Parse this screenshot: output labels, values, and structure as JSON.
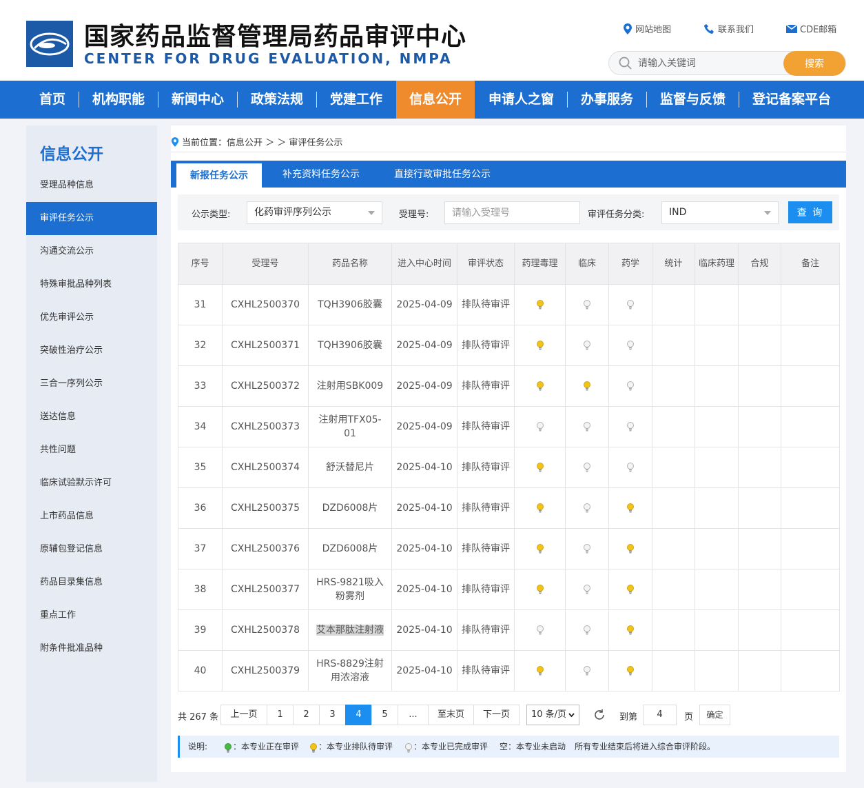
{
  "header": {
    "title": "国家药品监督管理局药品审评中心",
    "subtitle": "CENTER FOR DRUG EVALUATION, NMPA",
    "links": [
      {
        "label": "网站地图",
        "icon": "location-pin-icon"
      },
      {
        "label": "联系我们",
        "icon": "phone-icon"
      },
      {
        "label": "CDE邮箱",
        "icon": "mail-icon"
      }
    ],
    "search_placeholder": "请输入关键词",
    "search_button": "搜索"
  },
  "nav": {
    "items": [
      "首页",
      "机构职能",
      "新闻中心",
      "政策法规",
      "党建工作",
      "信息公开",
      "申请人之窗",
      "办事服务",
      "监督与反馈",
      "登记备案平台"
    ],
    "active": "信息公开"
  },
  "sidebar": {
    "title": "信息公开",
    "items": [
      "受理品种信息",
      "审评任务公示",
      "沟通交流公示",
      "特殊审批品种列表",
      "优先审评公示",
      "突破性治疗公示",
      "三合一序列公示",
      "送达信息",
      "共性问题",
      "临床试验默示许可",
      "上市药品信息",
      "原辅包登记信息",
      "药品目录集信息",
      "重点工作",
      "附条件批准品种"
    ],
    "active": "审评任务公示"
  },
  "breadcrumb": {
    "text": "当前位置：信息公开 ＞ ＞ 审评任务公示"
  },
  "tabs": {
    "items": [
      "新报任务公示",
      "补充资料任务公示",
      "直接行政审批任务公示"
    ],
    "active": "新报任务公示"
  },
  "filter": {
    "type_label": "公示类型:",
    "type_value": "化药审评序列公示",
    "accept_label": "受理号:",
    "accept_placeholder": "请输入受理号",
    "category_label": "审评任务分类:",
    "category_value": "IND",
    "query_button": "查 询"
  },
  "table": {
    "headers": [
      "序号",
      "受理号",
      "药品名称",
      "进入中心时间",
      "审评状态",
      "药理毒理",
      "临床",
      "药学",
      "统计",
      "临床药理",
      "合规",
      "备注"
    ],
    "rows": [
      {
        "no": "31",
        "id": "CXHL2500370",
        "name": "TQH3906胶囊",
        "date": "2025-04-09",
        "status": "排队待审评",
        "tox": "queued",
        "clin": "done",
        "pharm": "done"
      },
      {
        "no": "32",
        "id": "CXHL2500371",
        "name": "TQH3906胶囊",
        "date": "2025-04-09",
        "status": "排队待审评",
        "tox": "queued",
        "clin": "done",
        "pharm": "done"
      },
      {
        "no": "33",
        "id": "CXHL2500372",
        "name": "注射用SBK009",
        "date": "2025-04-09",
        "status": "排队待审评",
        "tox": "queued",
        "clin": "queued",
        "pharm": "done"
      },
      {
        "no": "34",
        "id": "CXHL2500373",
        "name": "注射用TFX05-01",
        "date": "2025-04-09",
        "status": "排队待审评",
        "tox": "done",
        "clin": "done",
        "pharm": "done"
      },
      {
        "no": "35",
        "id": "CXHL2500374",
        "name": "舒沃替尼片",
        "date": "2025-04-10",
        "status": "排队待审评",
        "tox": "queued",
        "clin": "done",
        "pharm": "done"
      },
      {
        "no": "36",
        "id": "CXHL2500375",
        "name": "DZD6008片",
        "date": "2025-04-10",
        "status": "排队待审评",
        "tox": "queued",
        "clin": "done",
        "pharm": "queued"
      },
      {
        "no": "37",
        "id": "CXHL2500376",
        "name": "DZD6008片",
        "date": "2025-04-10",
        "status": "排队待审评",
        "tox": "queued",
        "clin": "done",
        "pharm": "queued"
      },
      {
        "no": "38",
        "id": "CXHL2500377",
        "name": "HRS-9821吸入粉雾剂",
        "date": "2025-04-10",
        "status": "排队待审评",
        "tox": "queued",
        "clin": "done",
        "pharm": "queued"
      },
      {
        "no": "39",
        "id": "CXHL2500378",
        "name": "艾本那肽注射液",
        "date": "2025-04-10",
        "status": "排队待审评",
        "tox": "done",
        "clin": "done",
        "pharm": "queued"
      },
      {
        "no": "40",
        "id": "CXHL2500379",
        "name": "HRS-8829注射用浓溶液",
        "date": "2025-04-10",
        "status": "排队待审评",
        "tox": "queued",
        "clin": "done",
        "pharm": "queued"
      }
    ]
  },
  "pager": {
    "total": "共 267 条",
    "prev": "上一页",
    "pages": [
      "1",
      "2",
      "3",
      "4",
      "5",
      "..."
    ],
    "current": "4",
    "last": "至末页",
    "next": "下一页",
    "page_size": "10 条/页",
    "goto_label": "到第",
    "goto_value": "4",
    "page_unit": "页",
    "confirm": "确定"
  },
  "legend": {
    "title": "说明:",
    "in_review": "：本专业正在审评",
    "queued": "：本专业排队待审评",
    "done": "：本专业已完成审评",
    "empty": "空：本专业未启动",
    "note": "所有专业结束后将进入综合审评阶段。"
  },
  "colors": {
    "primary": "#1c6fd1",
    "accent": "#ef8b2c",
    "search_btn": "#f2a232",
    "bulb_green": "#4cb648",
    "bulb_yellow": "#f0c419",
    "bulb_gray": "#c8c8c8"
  }
}
